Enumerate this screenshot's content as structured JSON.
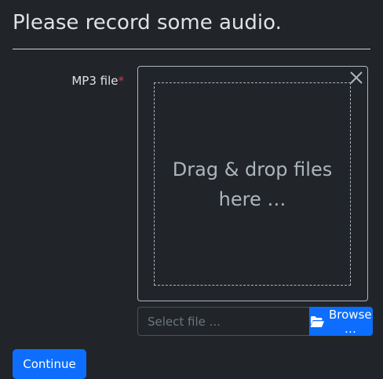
{
  "page": {
    "title": "Please record some audio."
  },
  "form": {
    "field_label": "MP3 file",
    "required_mark": "*",
    "dropzone": {
      "text": "Drag & drop files here …",
      "close_icon": "close-icon"
    },
    "file_input": {
      "value": "",
      "placeholder": "Select file ..."
    },
    "browse_button": {
      "label": "Browse …",
      "icon": "folder-open-icon"
    },
    "submit_label": "Continue"
  },
  "colors": {
    "background": "#212529",
    "accent": "#0d6efd",
    "required": "#dc3545",
    "muted_text": "#adb5bd"
  }
}
